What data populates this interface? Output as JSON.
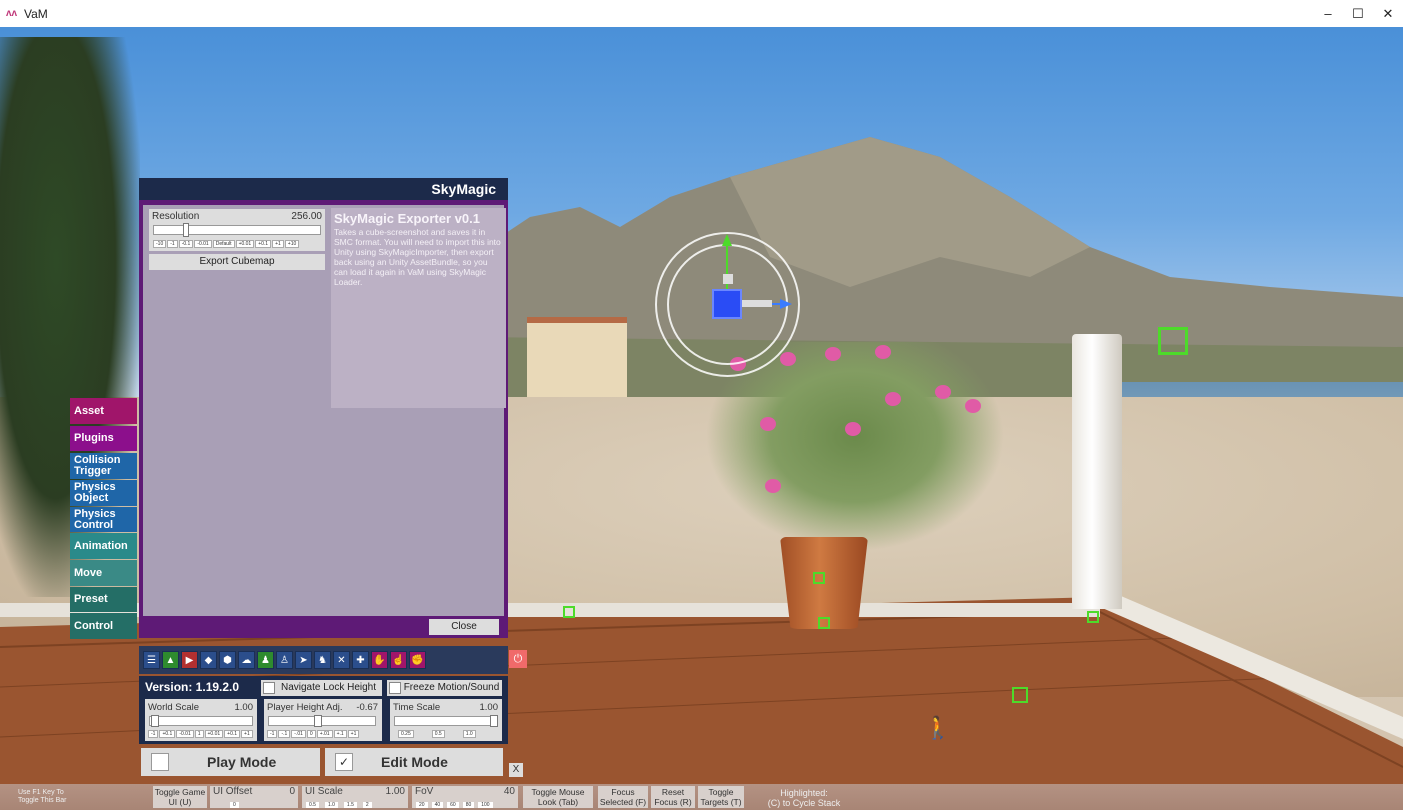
{
  "window": {
    "title": "VaM",
    "minimize": "–",
    "maximize": "☐",
    "close": "✕"
  },
  "side_tabs": [
    {
      "label": "Asset",
      "color": "#a0156a"
    },
    {
      "label": "Plugins",
      "color": "#8c0f8c"
    },
    {
      "label": "Collision Trigger",
      "color": "#1f66a8"
    },
    {
      "label": "Physics Object",
      "color": "#1f66a8"
    },
    {
      "label": "Physics Control",
      "color": "#1f66a8"
    },
    {
      "label": "Animation",
      "color": "#2a8a8a"
    },
    {
      "label": "Move",
      "color": "#3a8a86"
    },
    {
      "label": "Preset",
      "color": "#246e66"
    },
    {
      "label": "Control",
      "color": "#246e66"
    }
  ],
  "panel": {
    "title": "SkyMagic",
    "resolution": {
      "label": "Resolution",
      "value": "256.00",
      "ticks": [
        "-10",
        "-1",
        "-0.1",
        "-0.01",
        "Default",
        "+0.01",
        "+0.1",
        "+1",
        "+10"
      ]
    },
    "export_button": "Export Cubemap",
    "info_title": "SkyMagic Exporter v0.1",
    "info_text": "Takes a cube-screenshot and saves it in SMC format. You will need to import this into Unity using SkyMagicImporter, then export back using an Unity AssetBundle, so you can load it again in VaM using SkyMagic Loader.",
    "close_button": "Close"
  },
  "toolbar": {
    "icons": [
      "menu-icon",
      "scene-icon",
      "file-icon",
      "box-icon",
      "package-icon",
      "cloud-icon",
      "person-settings-icon",
      "person-icon",
      "cursor-icon",
      "people-icon",
      "tools-icon",
      "plus-icon",
      "hand-icon",
      "pointer-hand-icon",
      "grab-icon"
    ],
    "glyphs": [
      "☰",
      "▲",
      "▶",
      "◆",
      "⬢",
      "☁",
      "♟",
      "♙",
      "➤",
      "♞",
      "✕",
      "✚",
      "✋",
      "☝",
      "✊"
    ],
    "power": "⏻"
  },
  "version": {
    "label": "Version: 1.19.2.0",
    "navigate_lock": "Navigate Lock Height",
    "freeze_motion": "Freeze Motion/Sound",
    "world_scale": {
      "label": "World Scale",
      "value": "1.00",
      "ticks": [
        "-1",
        "+0.1",
        "-0.01",
        "1",
        "+0.01",
        "+0.1",
        "+1"
      ]
    },
    "player_height": {
      "label": "Player Height Adj.",
      "value": "-0.67",
      "ticks": [
        "-1",
        "-.1",
        "-.01",
        "0",
        "+.01",
        "+.1",
        "+1"
      ]
    },
    "time_scale": {
      "label": "Time Scale",
      "value": "1.00",
      "ticks": [
        "0.25",
        "0.5",
        "1.0"
      ]
    }
  },
  "modes": {
    "play": "Play Mode",
    "edit": "Edit Mode",
    "edit_check": "✓",
    "close_x": "X"
  },
  "bottom_bar": {
    "hint": "Use F1 Key To\nToggle This Bar",
    "toggle_game_ui": "Toggle Game UI (U)",
    "ui_offset": {
      "label": "UI Offset",
      "value": "0",
      "ticks": [
        "0"
      ]
    },
    "ui_scale": {
      "label": "UI Scale",
      "value": "1.00",
      "ticks": [
        "0.5",
        "1.0",
        "1.5",
        "2"
      ]
    },
    "fov": {
      "label": "FoV",
      "value": "40",
      "ticks": [
        "20",
        "40",
        "60",
        "80",
        "100"
      ]
    },
    "toggle_mouse_look": "Toggle Mouse Look (Tab)",
    "focus_selected": "Focus Selected (F)",
    "reset_focus": "Reset Focus (R)",
    "toggle_targets": "Toggle Targets (T)",
    "highlighted": "Highlighted:\n(C) to Cycle Stack"
  }
}
